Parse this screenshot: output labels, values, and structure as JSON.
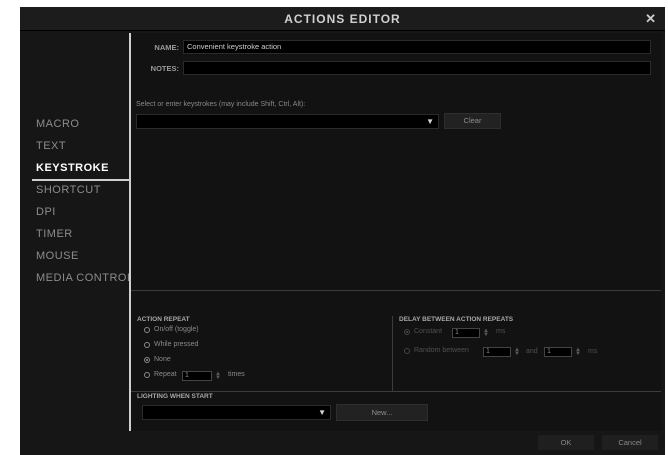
{
  "window": {
    "title": "ACTIONS EDITOR",
    "close_label": "✕"
  },
  "sidebar": {
    "items": [
      {
        "label": "MACRO"
      },
      {
        "label": "TEXT"
      },
      {
        "label": "KEYSTROKE"
      },
      {
        "label": "SHORTCUT"
      },
      {
        "label": "DPI"
      },
      {
        "label": "TIMER"
      },
      {
        "label": "MOUSE"
      },
      {
        "label": "MEDIA CONTROL"
      }
    ],
    "active": "KEYSTROKE"
  },
  "form": {
    "name_label": "NAME:",
    "name_value": "Convenient keystroke action",
    "notes_label": "NOTES:",
    "notes_value": ""
  },
  "keystroke": {
    "hint": "Select or enter keystrokes (may include Shift, Ctrl, Alt):",
    "selected": "",
    "clear_label": "Clear"
  },
  "action_repeat": {
    "title": "ACTION REPEAT",
    "options": [
      {
        "label": "On/off (toggle)",
        "checked": false
      },
      {
        "label": "While pressed",
        "checked": false
      },
      {
        "label": "None",
        "checked": true
      },
      {
        "label": "Repeat",
        "checked": false
      }
    ],
    "repeat_value": "1",
    "times_label": "times"
  },
  "delay": {
    "title": "DELAY BETWEEN ACTION REPEATS",
    "constant_label": "Constant",
    "constant_value": "1",
    "constant_unit": "ms",
    "random_label": "Random between",
    "random_from": "1",
    "and_label": "and",
    "random_to": "1",
    "random_unit": "ms",
    "constant_checked": true,
    "random_checked": false
  },
  "lighting": {
    "title": "LIGHTING WHEN START",
    "selected": "",
    "new_label": "New..."
  },
  "footer": {
    "ok_label": "OK",
    "cancel_label": "Cancel"
  },
  "icons": {
    "caret": "▼",
    "spin": "▲▼"
  }
}
